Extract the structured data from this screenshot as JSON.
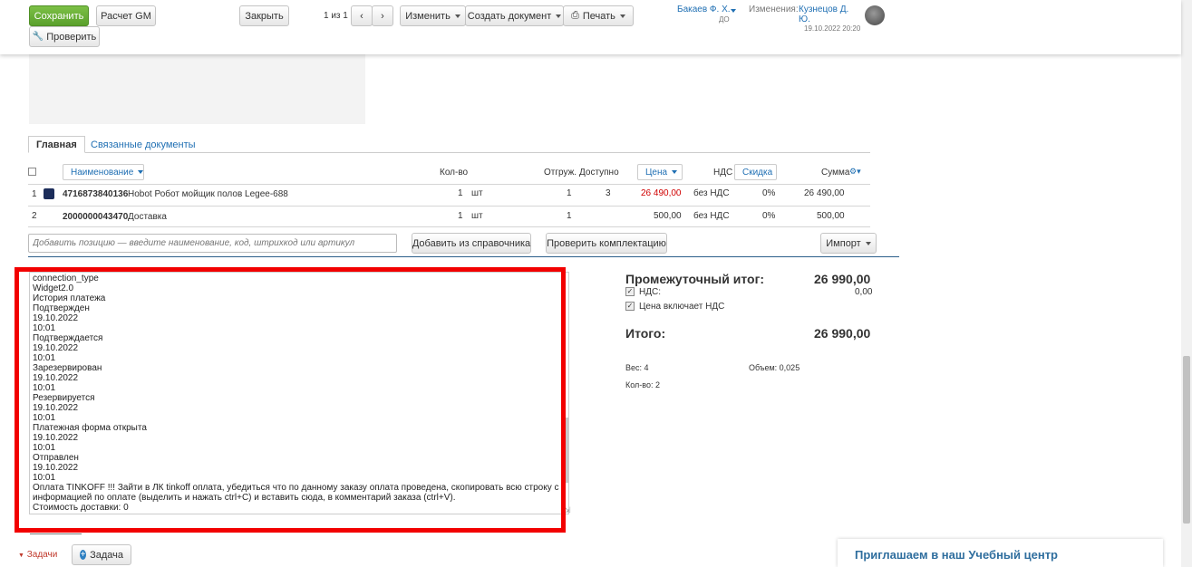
{
  "toolbar": {
    "save_label": "Сохранить",
    "calc_label": "Расчет GM",
    "check_label": "Проверить",
    "close_label": "Закрыть",
    "pager": "1 из 1",
    "edit_label": "Изменить",
    "create_doc_label": "Создать документ",
    "print_label": "Печать",
    "user_name": "Бакаев Ф. Х.",
    "user_sub": "ДО",
    "changes_label": "Изменения:",
    "changes_user": "Кузнецов Д. Ю.",
    "changes_time": "19.10.2022 20:20"
  },
  "tabs": [
    {
      "label": "Главная"
    },
    {
      "label": "Связанные документы"
    }
  ],
  "table": {
    "headers": {
      "name": "Наименование",
      "qty": "Кол-во",
      "shipped": "Отгруж.",
      "available": "Доступно",
      "price": "Цена",
      "vat": "НДС",
      "discount": "Скидка",
      "sum": "Сумма"
    },
    "rows": [
      {
        "num": "1",
        "code": "4716873840136",
        "name": "Hobot Робот мойщик полов Legee-688",
        "qty": "1",
        "unit": "шт",
        "shipped": "1",
        "available": "3",
        "price": "26 490,00",
        "vat": "без НДС",
        "discount": "0%",
        "sum": "26 490,00"
      },
      {
        "num": "2",
        "code": "2000000043470",
        "name": "Доставка",
        "qty": "1",
        "unit": "шт",
        "shipped": "1",
        "available": "",
        "price": "500,00",
        "vat": "без НДС",
        "discount": "0%",
        "sum": "500,00"
      }
    ],
    "add_placeholder": "Добавить позицию — введите наименование, код, штрихкод или артикул",
    "add_from_catalog": "Добавить из справочника",
    "check_kit": "Проверить комплектацию",
    "import_label": "Импорт"
  },
  "comment_lines": [
    "connection_type",
    "Widget2.0",
    "История платежа",
    "Подтвержден",
    "19.10.2022",
    "10:01",
    "Подтверждается",
    "19.10.2022",
    "10:01",
    "Зарезервирован",
    "19.10.2022",
    "10:01",
    "Резервируется",
    "19.10.2022",
    "10:01",
    "Платежная форма открыта",
    "19.10.2022",
    "10:01",
    "Отправлен",
    "19.10.2022",
    "10:01",
    "Оплата TINKOFF !!! Зайти в ЛК tinkoff оплата, убедиться что по данному заказу оплата проведена, скопировать всю строку с",
    "информацией по оплате (выделить и нажать ctrl+C) и вставить сюда, в комментарий заказа (ctrl+V).",
    "Стоимость доставки: 0"
  ],
  "totals": {
    "subtotal_label": "Промежуточный итог:",
    "subtotal_value": "26 990,00",
    "vat_label": "НДС:",
    "vat_value": "0,00",
    "price_incl_vat_label": "Цена включает НДС",
    "total_label": "Итого:",
    "total_value": "26 990,00",
    "weight": "Вес: 4",
    "volume": "Объем: 0,025",
    "count": "Кол-во: 2"
  },
  "tasks": {
    "tasks_label": "Задачи",
    "add_task_label": "Задача"
  },
  "promo": {
    "title": "Приглашаем в наш Учебный центр"
  },
  "colors": {
    "accent_green": "#5aa02c",
    "link_blue": "#1f6fb3",
    "highlight_red": "#f20000",
    "price_red": "#d00000"
  }
}
